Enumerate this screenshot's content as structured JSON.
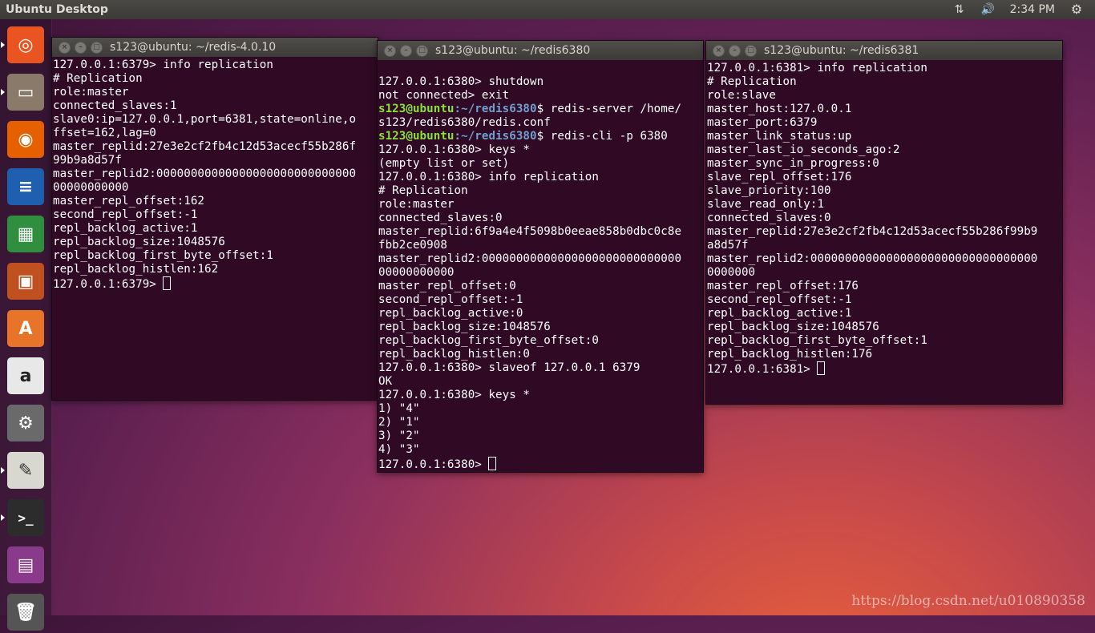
{
  "top_panel": {
    "title": "Ubuntu Desktop",
    "time": "2:34 PM",
    "network_icon": "⇅",
    "volume_icon": "🔊",
    "gear_icon": "⚙"
  },
  "launcher": {
    "items": [
      {
        "name": "ubuntu-dash-icon",
        "glyph": "◎",
        "color": "#e95420"
      },
      {
        "name": "files-icon",
        "glyph": "▭",
        "color": "#8a7a6a"
      },
      {
        "name": "firefox-icon",
        "glyph": "◉",
        "color": "#e66000"
      },
      {
        "name": "writer-icon",
        "glyph": "≡",
        "color": "#1f5faf"
      },
      {
        "name": "calc-icon",
        "glyph": "▦",
        "color": "#2f8f3f"
      },
      {
        "name": "impress-icon",
        "glyph": "▣",
        "color": "#c05020"
      },
      {
        "name": "software-center-icon",
        "glyph": "A",
        "color": "#e8742a"
      },
      {
        "name": "amazon-icon",
        "glyph": "a",
        "color": "#e8e8e8"
      },
      {
        "name": "settings-icon",
        "glyph": "⚙",
        "color": "#6a6a6a"
      },
      {
        "name": "text-editor-icon",
        "glyph": "✎",
        "color": "#d8d8d0"
      },
      {
        "name": "terminal-icon",
        "glyph": ">_",
        "color": "#2c2c2c"
      },
      {
        "name": "workspace-switcher-icon",
        "glyph": "▤",
        "color": "#8a3a8a"
      },
      {
        "name": "trash-icon",
        "glyph": "🗑",
        "color": "#555555"
      }
    ]
  },
  "terminals": [
    {
      "title": "s123@ubuntu: ~/redis-4.0.10",
      "lines": [
        "127.0.0.1:6379> info replication",
        "# Replication",
        "role:master",
        "connected_slaves:1",
        "slave0:ip=127.0.0.1,port=6381,state=online,o",
        "ffset=162,lag=0",
        "master_replid:27e3e2cf2fb4c12d53acecf55b286f",
        "99b9a8d57f",
        "master_replid2:00000000000000000000000000000",
        "00000000000",
        "master_repl_offset:162",
        "second_repl_offset:-1",
        "repl_backlog_active:1",
        "repl_backlog_size:1048576",
        "repl_backlog_first_byte_offset:1",
        "repl_backlog_histlen:162"
      ],
      "prompt": "127.0.0.1:6379> "
    },
    {
      "title": "s123@ubuntu: ~/redis6380",
      "lines_before": [
        "",
        "127.0.0.1:6380> shutdown",
        "not connected> exit"
      ],
      "shell_user": "s123@ubuntu",
      "shell_path": ":~/redis6380",
      "cmd1_a": "$ redis-server /home/",
      "cmd1_b": "s123/redis6380/redis.conf",
      "cmd2": "$ redis-cli -p 6380",
      "lines_after": [
        "127.0.0.1:6380> keys *",
        "(empty list or set)",
        "127.0.0.1:6380> info replication",
        "# Replication",
        "role:master",
        "connected_slaves:0",
        "master_replid:6f9a4e4f5098b0eeae858b0dbc0c8e",
        "fbb2ce0908",
        "master_replid2:00000000000000000000000000000",
        "00000000000",
        "master_repl_offset:0",
        "second_repl_offset:-1",
        "repl_backlog_active:0",
        "repl_backlog_size:1048576",
        "repl_backlog_first_byte_offset:0",
        "repl_backlog_histlen:0",
        "127.0.0.1:6380> slaveof 127.0.0.1 6379",
        "OK",
        "127.0.0.1:6380> keys *",
        "1) \"4\"",
        "2) \"1\"",
        "3) \"2\"",
        "4) \"3\""
      ],
      "prompt": "127.0.0.1:6380> "
    },
    {
      "title": "s123@ubuntu: ~/redis6381",
      "lines": [
        "127.0.0.1:6381> info replication",
        "# Replication",
        "role:slave",
        "master_host:127.0.0.1",
        "master_port:6379",
        "master_link_status:up",
        "master_last_io_seconds_ago:2",
        "master_sync_in_progress:0",
        "slave_repl_offset:176",
        "slave_priority:100",
        "slave_read_only:1",
        "connected_slaves:0",
        "master_replid:27e3e2cf2fb4c12d53acecf55b286f99b9",
        "a8d57f",
        "master_replid2:000000000000000000000000000000000",
        "0000000",
        "master_repl_offset:176",
        "second_repl_offset:-1",
        "repl_backlog_active:1",
        "repl_backlog_size:1048576",
        "repl_backlog_first_byte_offset:1",
        "repl_backlog_histlen:176"
      ],
      "prompt": "127.0.0.1:6381> "
    }
  ],
  "watermark": "https://blog.csdn.net/u010890358"
}
